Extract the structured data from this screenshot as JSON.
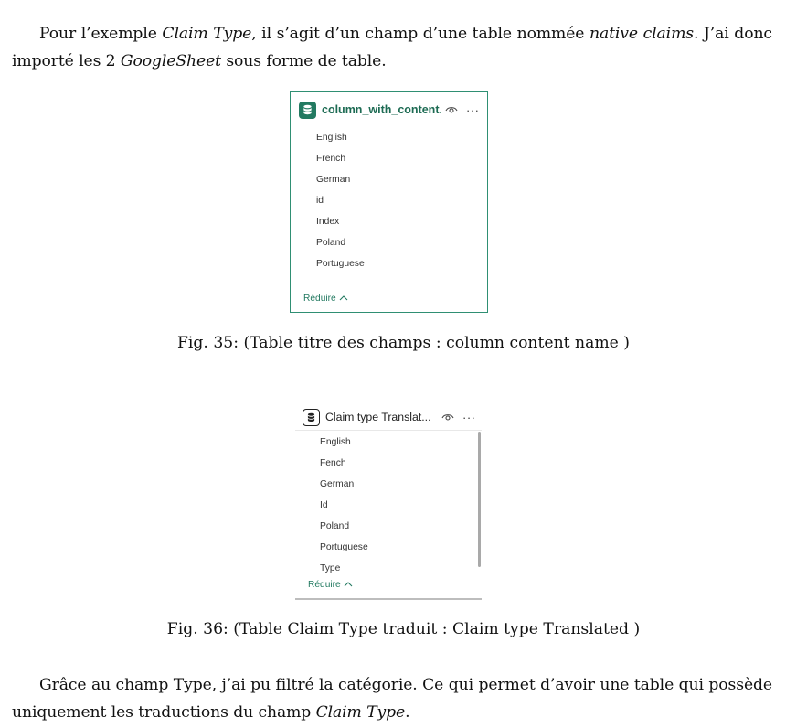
{
  "intro": {
    "part1": "Pour l’exemple ",
    "italic1": "Claim Type",
    "part2": ", il s’agit d’un champ d’une table nommée ",
    "italic2": "native claims",
    "part3": ". J’ai donc importé les 2 ",
    "italic3": "GoogleSheet",
    "part4": " sous forme de table."
  },
  "table1": {
    "title": "column_with_content...",
    "fields": [
      "English",
      "French",
      "German",
      "id",
      "Index",
      "Poland",
      "Portuguese"
    ],
    "reduce_label": "Réduire",
    "icon": "database-icon",
    "accent": "#237a61"
  },
  "fig35": {
    "caption": "Fig. 35: (Table titre des champs : column content name )"
  },
  "table2": {
    "title": "Claim type Translat...",
    "fields": [
      "English",
      "Fench",
      "German",
      "Id",
      "Poland",
      "Portuguese",
      "Type"
    ],
    "reduce_label": "Réduire",
    "icon": "database-icon"
  },
  "fig36": {
    "caption": "Fig. 36: (Table Claim Type traduit : Claim type Translated )"
  },
  "outro": {
    "part1": "Grâce au champ Type, j’ai pu filtré la catégorie. Ce qui permet d’avoir une table qui possède uniquement les traductions du champ ",
    "italic1": "Claim Type",
    "part2": "."
  }
}
